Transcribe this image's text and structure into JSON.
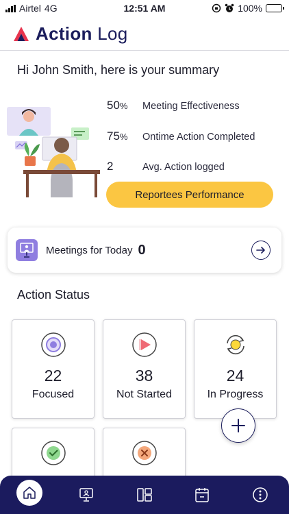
{
  "status_bar": {
    "carrier": "Airtel",
    "network": "4G",
    "time": "12:51 AM",
    "battery": "100%"
  },
  "header": {
    "title_bold": "Action",
    "title_light": "Log"
  },
  "summary": {
    "greeting": "Hi John Smith, here is your summary",
    "stats": [
      {
        "value": "50",
        "unit": "%",
        "label": "Meeting Effectiveness"
      },
      {
        "value": "75",
        "unit": "%",
        "label": "Ontime Action Completed"
      },
      {
        "value": "2",
        "unit": "",
        "label": "Avg. Action logged"
      }
    ],
    "button_label": "Reportees Performance"
  },
  "meetings": {
    "label": "Meetings for Today",
    "count": "0"
  },
  "action_status": {
    "title": "Action Status",
    "cards": [
      {
        "count": "22",
        "label": "Focused",
        "icon": "focus-icon"
      },
      {
        "count": "38",
        "label": "Not Started",
        "icon": "play-icon"
      },
      {
        "count": "24",
        "label": "In Progress",
        "icon": "refresh-icon"
      },
      {
        "count": "",
        "label": "",
        "icon": "check-icon"
      },
      {
        "count": "",
        "label": "",
        "icon": "cancel-icon"
      }
    ]
  },
  "bottom_nav": {
    "items": [
      "home-icon",
      "meetings-icon",
      "dashboard-icon",
      "calendar-icon",
      "more-icon"
    ]
  },
  "colors": {
    "brand_navy": "#1b1d5c",
    "accent_yellow": "#fbc642",
    "purple": "#8f7ee0",
    "nav_bg": "#1b1b5e"
  }
}
